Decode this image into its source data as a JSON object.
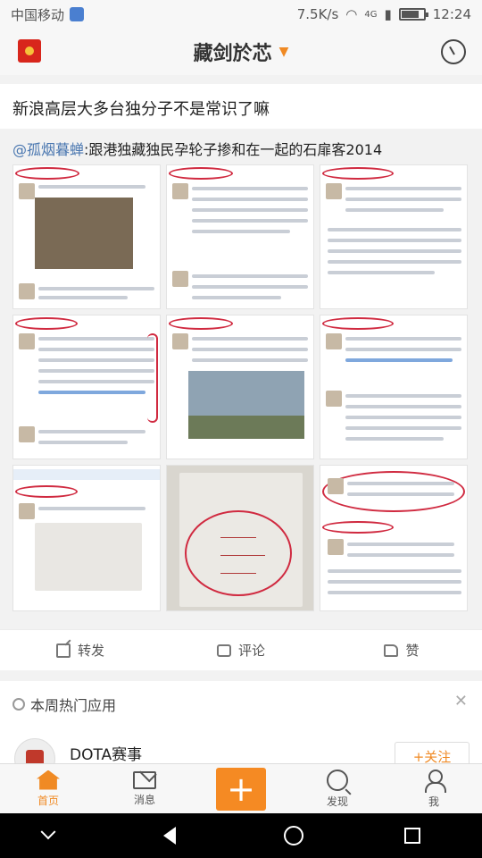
{
  "status_bar": {
    "carrier": "中国移动",
    "speed": "7.5K/s",
    "network": "4G",
    "time": "12:24",
    "battery_level": 0.8
  },
  "header": {
    "title": "藏剑於芯"
  },
  "post": {
    "text": "新浪高层大多台独分子不是常识了嘛",
    "repost_mention": "@孤烟暮蝉",
    "repost_text": ":跟港独藏独民孕轮子掺和在一起的石扉客2014"
  },
  "actions": {
    "repost_label": "转发",
    "comment_label": "评论",
    "like_label": "赞"
  },
  "hot_apps": {
    "title": "本周热门应用",
    "app_name": "DOTA赛事",
    "follow_label": "+关注"
  },
  "tabbar": {
    "home": "首页",
    "messages": "消息",
    "discover": "发现",
    "me": "我"
  },
  "colors": {
    "accent": "#f08a24",
    "mention": "#4a77b0",
    "annotation_red": "#d02a40"
  }
}
